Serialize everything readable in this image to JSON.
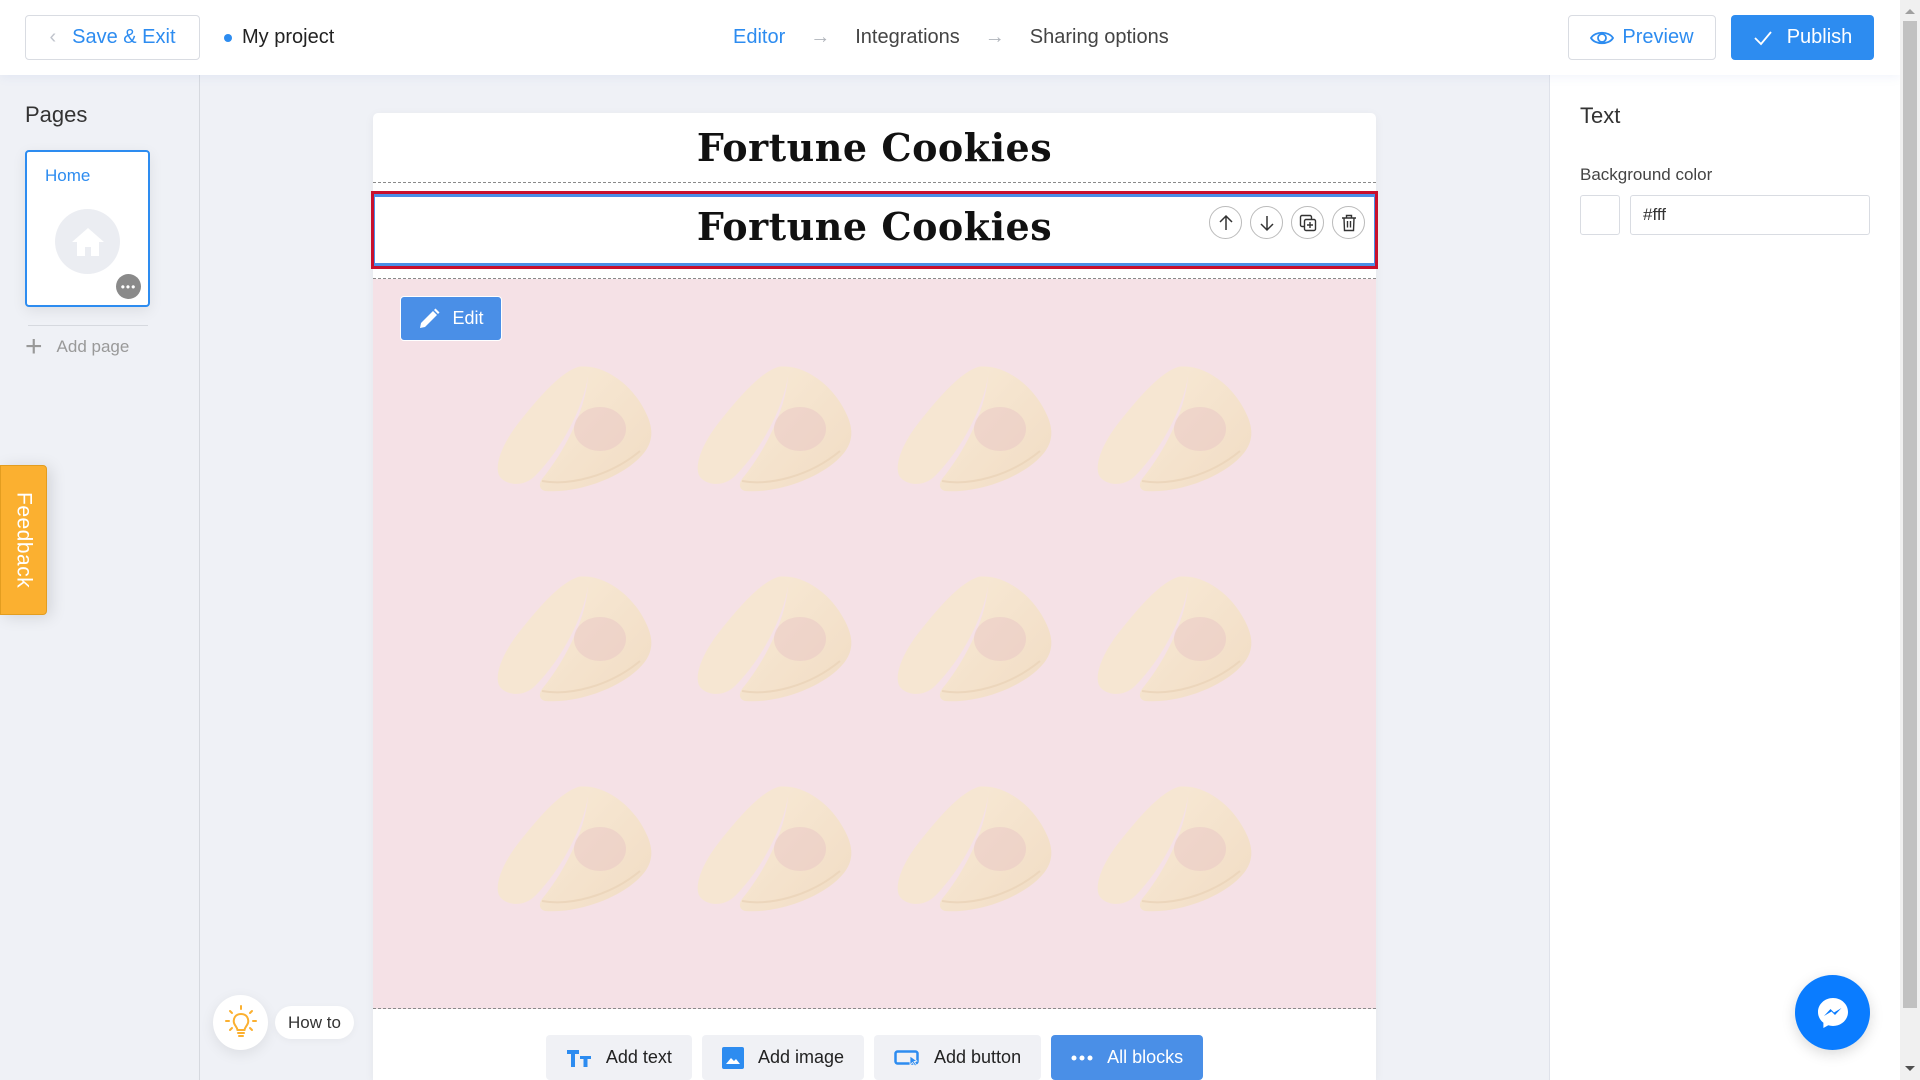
{
  "header": {
    "save_exit_label": "Save & Exit",
    "project_name": "My project",
    "steps": [
      {
        "label": "Editor",
        "active": true
      },
      {
        "label": "Integrations",
        "active": false
      },
      {
        "label": "Sharing options",
        "active": false
      }
    ],
    "step_arrow": "→",
    "preview_label": "Preview",
    "publish_label": "Publish"
  },
  "sidebar": {
    "title": "Pages",
    "pages": [
      {
        "name": "Home",
        "icon": "home-icon",
        "selected": true
      }
    ],
    "page_more_glyph": "•••",
    "add_page_label": "Add page",
    "add_page_glyph": "+"
  },
  "feedback_label": "Feedback",
  "howto_label": "How to",
  "canvas": {
    "blocks": [
      {
        "type": "text",
        "title": "Fortune Cookies"
      },
      {
        "type": "text",
        "title": "Fortune Cookies",
        "selected": true
      }
    ],
    "block_actions": [
      "move-up",
      "move-down",
      "duplicate",
      "delete"
    ],
    "hero": {
      "edit_label": "Edit",
      "background_color": "#f5e1e6",
      "pattern": "fortune-cookie",
      "pattern_rows": 3,
      "pattern_cols": 4
    },
    "add_buttons": [
      {
        "label": "Add text",
        "icon": "text-icon"
      },
      {
        "label": "Add image",
        "icon": "image-icon"
      },
      {
        "label": "Add button",
        "icon": "button-icon"
      },
      {
        "label": "All blocks",
        "icon": "more-icon",
        "primary": true
      }
    ]
  },
  "right_panel": {
    "title": "Text",
    "background_color_label": "Background color",
    "background_color_value": "#fff"
  },
  "colors": {
    "accent": "#2d8cf0",
    "selection_outline": "#c8102e",
    "selection_inner": "#4a8fe7",
    "feedback": "#fbb030",
    "messenger": "#0a7cff"
  }
}
